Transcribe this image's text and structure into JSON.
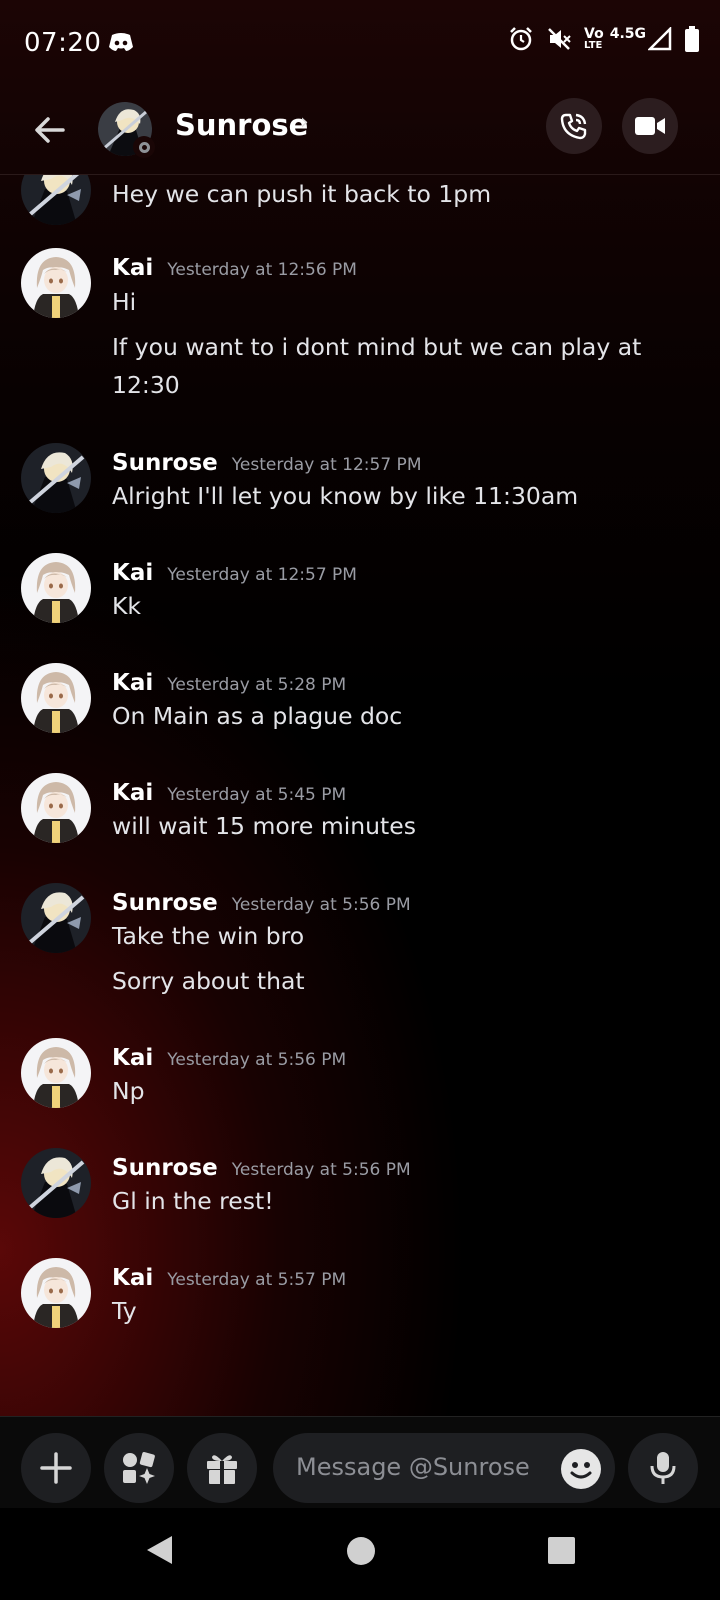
{
  "status_bar": {
    "time": "07:20",
    "network": "4.5G",
    "volte": "Vo",
    "volte_sub": "LTE",
    "icons": [
      "discord-icon",
      "alarm-icon",
      "mute-icon",
      "volte-icon",
      "signal-icon",
      "battery-icon"
    ]
  },
  "header": {
    "name": "Sunrose",
    "chevron": "›",
    "icons": [
      "back-arrow-icon",
      "voice-call-icon",
      "video-call-icon"
    ]
  },
  "messages": [
    {
      "author": "",
      "time": "",
      "lines": [
        "Hey we can push it back to 1pm"
      ],
      "avatar": "sunrose"
    },
    {
      "author": "Kai",
      "time": "Yesterday at 12:56 PM",
      "lines": [
        "Hi",
        "If you want to i dont mind but we can play at",
        "12:30"
      ],
      "avatar": "kai"
    },
    {
      "author": "Sunrose",
      "time": "Yesterday at 12:57 PM",
      "lines": [
        "Alright I'll let you know by like 11:30am"
      ],
      "avatar": "sunrose"
    },
    {
      "author": "Kai",
      "time": "Yesterday at 12:57 PM",
      "lines": [
        "Kk"
      ],
      "avatar": "kai"
    },
    {
      "author": "Kai",
      "time": "Yesterday at 5:28 PM",
      "lines": [
        "On Main as a plague doc"
      ],
      "avatar": "kai"
    },
    {
      "author": "Kai",
      "time": "Yesterday at 5:45 PM",
      "lines": [
        "will wait 15 more minutes"
      ],
      "avatar": "kai"
    },
    {
      "author": "Sunrose",
      "time": "Yesterday at 5:56 PM",
      "lines": [
        "Take the win bro",
        "Sorry about that"
      ],
      "avatar": "sunrose"
    },
    {
      "author": "Kai",
      "time": "Yesterday at 5:56 PM",
      "lines": [
        "Np"
      ],
      "avatar": "kai"
    },
    {
      "author": "Sunrose",
      "time": "Yesterday at 5:56 PM",
      "lines": [
        "Gl in the rest!"
      ],
      "avatar": "sunrose"
    },
    {
      "author": "Kai",
      "time": "Yesterday at 5:57 PM",
      "lines": [
        "Ty"
      ],
      "avatar": "kai"
    }
  ],
  "composer": {
    "placeholder": "Message @Sunrose",
    "icons": [
      "plus-icon",
      "apps-icon",
      "gift-icon",
      "emoji-icon",
      "microphone-icon"
    ]
  },
  "nav": {
    "icons": [
      "nav-back-icon",
      "nav-home-icon",
      "nav-recents-icon"
    ]
  },
  "colors": {
    "accent_bg": "#5f0808",
    "text": "#e3e4e8",
    "muted": "#9a9ca4",
    "button_bg": "#1e1f22"
  }
}
